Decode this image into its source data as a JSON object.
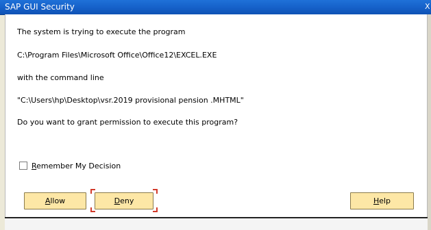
{
  "window": {
    "title": "SAP GUI Security",
    "close_glyph": "X"
  },
  "message": {
    "line1": "The system is trying to execute the program",
    "program_path": "C:\\Program Files\\Microsoft Office\\Office12\\EXCEL.EXE",
    "line3": "with the command line",
    "command_line": "\"C:\\Users\\hp\\Desktop\\vsr.2019 provisional pension .MHTML\"",
    "question": "Do you want to grant permission to execute this program?"
  },
  "remember": {
    "label_mnemonic": "R",
    "label_rest": "emember My Decision",
    "checked": false
  },
  "buttons": {
    "allow_mnemonic": "A",
    "allow_rest": "llow",
    "deny_mnemonic": "D",
    "deny_rest": "eny",
    "help_mnemonic": "H",
    "help_rest": "elp",
    "color": "#fde7a6",
    "focused": "Deny"
  },
  "colors": {
    "titlebar": "#1560c8",
    "focus_corners": "#d23a2a"
  }
}
